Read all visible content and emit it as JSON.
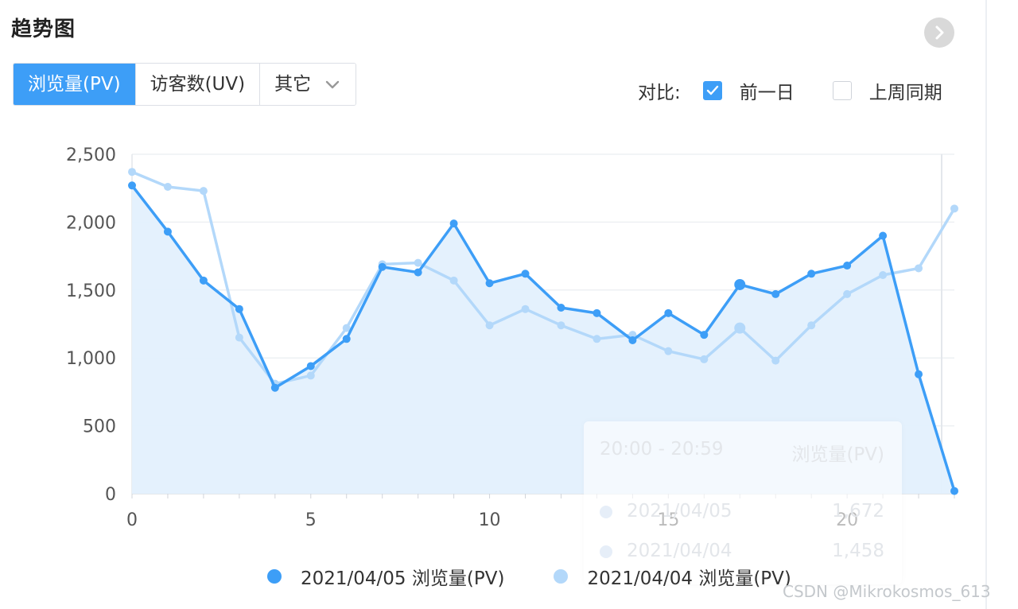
{
  "panel": {
    "title": "趋势图"
  },
  "tabs": [
    {
      "label": "浏览量(PV)",
      "active": true
    },
    {
      "label": "访客数(UV)",
      "active": false
    },
    {
      "label": "其它",
      "active": false
    }
  ],
  "compare": {
    "label": "对比:",
    "options": [
      {
        "label": "前一日",
        "checked": true
      },
      {
        "label": "上周同期",
        "checked": false
      }
    ]
  },
  "colors": {
    "accent": "#3d9ef7",
    "secondary": "#b3d8fa",
    "area": "#e3f0fd"
  },
  "chart_data": {
    "type": "line",
    "x": [
      0,
      1,
      2,
      3,
      4,
      5,
      6,
      7,
      8,
      9,
      10,
      11,
      12,
      13,
      14,
      15,
      16,
      17,
      18,
      19,
      20,
      21,
      22,
      23
    ],
    "xticks": [
      0,
      5,
      10,
      15,
      20
    ],
    "ylim": [
      0,
      2500
    ],
    "yticks": [
      0,
      500,
      1000,
      1500,
      2000,
      2500
    ],
    "ytick_labels": [
      "0",
      "500",
      "1,000",
      "1,500",
      "2,000",
      "2,500"
    ],
    "grid": true,
    "legend_position": "bottom",
    "series": [
      {
        "name": "2021/04/05 浏览量(PV)",
        "color": "#3d9ef7",
        "area": true,
        "values": [
          2270,
          1930,
          1570,
          1360,
          780,
          940,
          1140,
          1670,
          1630,
          1990,
          1550,
          1620,
          1370,
          1330,
          1130,
          1330,
          1170,
          1540,
          1470,
          1620,
          1680,
          1900,
          880,
          20
        ]
      },
      {
        "name": "2021/04/04 浏览量(PV)",
        "color": "#b3d8fa",
        "area": false,
        "values": [
          2370,
          2260,
          2230,
          1150,
          810,
          870,
          1220,
          1690,
          1700,
          1570,
          1240,
          1360,
          1240,
          1140,
          1170,
          1050,
          990,
          1220,
          980,
          1240,
          1470,
          1610,
          1660,
          2100
        ]
      }
    ],
    "tooltip": {
      "time": "20:00 - 20:59",
      "metric": "浏览量(PV)",
      "rows": [
        {
          "label": "2021/04/05",
          "value": "1,672"
        },
        {
          "label": "2021/04/04",
          "value": "1,458"
        }
      ]
    }
  },
  "watermark": "CSDN @Mikrokosmos_613"
}
